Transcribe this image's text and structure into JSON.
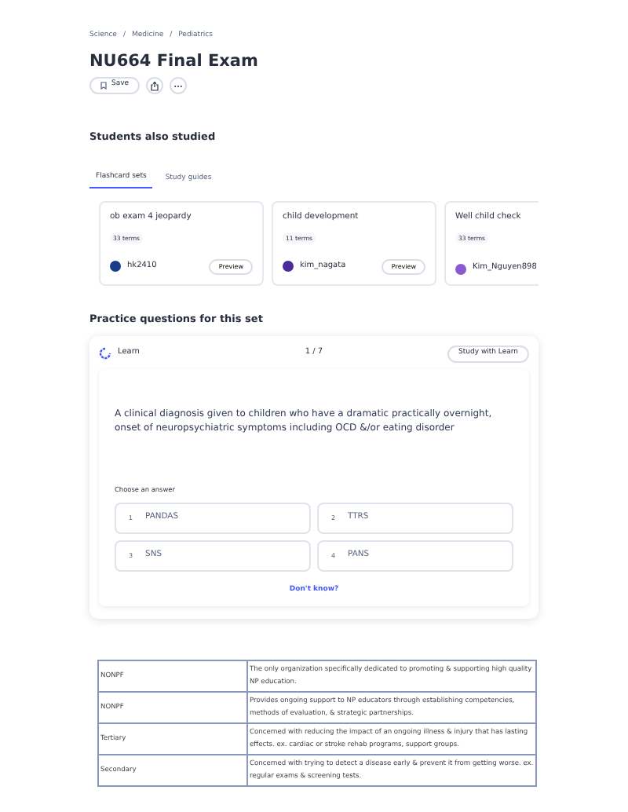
{
  "breadcrumbs": [
    {
      "text": "Science"
    },
    {
      "separator": "/",
      "text": "Medicine"
    },
    {
      "separator": "/",
      "text": "Pediatrics"
    }
  ],
  "title": "NU664 Final Exam",
  "actions": {
    "save": "Save"
  },
  "also_studied": {
    "heading": "Students also studied",
    "tabs": [
      {
        "label": "Flashcard sets",
        "selected": true
      },
      {
        "label": "Study guides",
        "selected": false
      }
    ],
    "cards": [
      {
        "title": "ob exam 4 jeopardy",
        "terms": "33 terms",
        "author": "hk2410",
        "preview": "Preview",
        "color": "#1a3a8a"
      },
      {
        "title": "child development",
        "terms": "11 terms",
        "author": "kim_nagata",
        "preview": "Preview",
        "color": "#4b2a9a"
      },
      {
        "title": "Well child check",
        "terms": "33 terms",
        "author": "Kim_Nguyen898",
        "color": "#8a5ad0"
      }
    ]
  },
  "practice": {
    "heading": "Practice questions for this set",
    "mode": "Learn",
    "progress": "1 / 7",
    "study_button": "Study with Learn",
    "question": "A clinical diagnosis given to children who have a dramatic practically overnight, onset of neuropsychiatric symptoms including OCD &/or eating disorder",
    "prompt": "Choose an answer",
    "answers": [
      {
        "number": "1",
        "text": "PANDAS"
      },
      {
        "number": "2",
        "text": "TTRS"
      },
      {
        "number": "3",
        "text": "SNS"
      },
      {
        "number": "4",
        "text": "PANS"
      }
    ],
    "dont_know": "Don't know?"
  },
  "table": {
    "rows": [
      [
        "NONPF",
        "The only organization specifically dedicated to promoting & supporting high quality NP education."
      ],
      [
        "NONPF",
        "Provides ongoing support to NP educators through establishing competencies, methods of evaluation, & strategic partnerships."
      ],
      [
        "Tertiary",
        "Concerned with reducing the impact of an ongoing illness & injury that has lasting effects. ex. cardiac or stroke rehab programs, support groups."
      ],
      [
        "Secondary",
        "Concerned with trying to detect a disease early & prevent it from getting worse. ex. regular exams & screening tests."
      ]
    ]
  }
}
